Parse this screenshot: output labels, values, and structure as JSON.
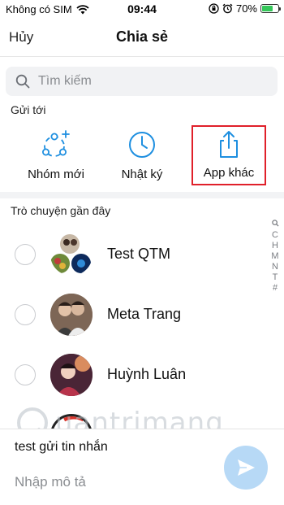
{
  "status_bar": {
    "carrier": "Không có SIM",
    "time": "09:44",
    "battery_percent": "70%",
    "battery_level": 0.7
  },
  "nav": {
    "cancel": "Hủy",
    "title": "Chia sẻ"
  },
  "search": {
    "placeholder": "Tìm kiếm"
  },
  "send_to": {
    "label": "Gửi tới",
    "targets": [
      {
        "label": "Nhóm mới",
        "icon": "new-group-icon"
      },
      {
        "label": "Nhật ký",
        "icon": "clock-icon"
      },
      {
        "label": "App khác",
        "icon": "share-icon"
      }
    ]
  },
  "recent": {
    "label": "Trò chuyện gần đây",
    "contacts": [
      {
        "name": "Test QTM"
      },
      {
        "name": "Meta Trang"
      },
      {
        "name": "Huỳnh Luân"
      }
    ],
    "index": [
      "C",
      "H",
      "M",
      "N",
      "T",
      "#"
    ]
  },
  "watermark": "uantrimang",
  "composer": {
    "message": "test gửi tin nhắn",
    "placeholder": "Nhập mô tả"
  },
  "colors": {
    "accent": "#1e8fe0",
    "highlight": "#e0202a",
    "send_button": "#b7d9f6"
  }
}
